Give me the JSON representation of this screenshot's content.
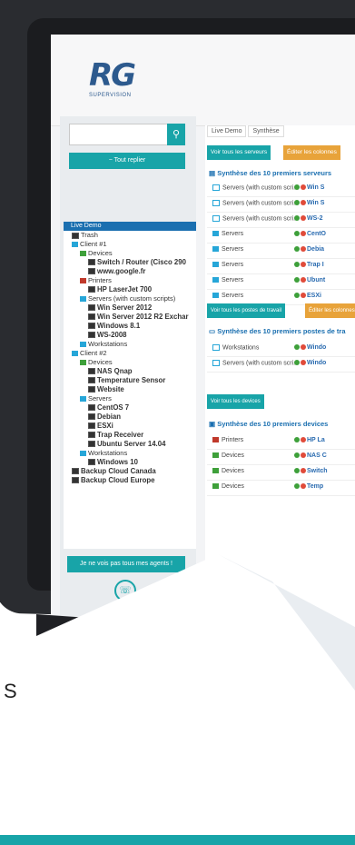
{
  "logo": {
    "mark": "RG",
    "subtitle": "SUPERVISION"
  },
  "sidebar": {
    "search_icon": "search-icon",
    "collapse_label": "− Tout replier",
    "agents_label": "Je ne vois pas tous mes agents !",
    "phone_icon": "phone-icon"
  },
  "tree": {
    "root": "Live Demo",
    "items": [
      {
        "label": "Trash",
        "level": 1,
        "bold": false,
        "icon": "trash"
      },
      {
        "label": "Client #1",
        "level": 1,
        "bold": false,
        "icon": "folder"
      },
      {
        "label": "Devices",
        "level": 2,
        "bold": false,
        "icon": "green"
      },
      {
        "label": "Switch / Router (Cisco 290",
        "level": 3,
        "bold": true,
        "icon": "dev"
      },
      {
        "label": "www.google.fr",
        "level": 3,
        "bold": true,
        "icon": "dev"
      },
      {
        "label": "Printers",
        "level": 2,
        "bold": false,
        "icon": "red"
      },
      {
        "label": "HP LaserJet 700",
        "level": 3,
        "bold": true,
        "icon": "dev"
      },
      {
        "label": "Servers (with custom scripts)",
        "level": 2,
        "bold": false,
        "icon": "folder"
      },
      {
        "label": "Win Server 2012",
        "level": 3,
        "bold": true,
        "icon": "dev"
      },
      {
        "label": "Win Server 2012 R2 Exchar",
        "level": 3,
        "bold": true,
        "icon": "dev"
      },
      {
        "label": "Windows 8.1",
        "level": 3,
        "bold": true,
        "icon": "dev"
      },
      {
        "label": "WS-2008",
        "level": 3,
        "bold": true,
        "icon": "dev"
      },
      {
        "label": "Workstations",
        "level": 2,
        "bold": false,
        "icon": "folder"
      },
      {
        "label": "Client #2",
        "level": 1,
        "bold": false,
        "icon": "folder"
      },
      {
        "label": "Devices",
        "level": 2,
        "bold": false,
        "icon": "green"
      },
      {
        "label": "NAS Qnap",
        "level": 3,
        "bold": true,
        "icon": "dev"
      },
      {
        "label": "Temperature Sensor",
        "level": 3,
        "bold": true,
        "icon": "dev"
      },
      {
        "label": "Website",
        "level": 3,
        "bold": true,
        "icon": "dev"
      },
      {
        "label": "Servers",
        "level": 2,
        "bold": false,
        "icon": "folder"
      },
      {
        "label": "CentOS 7",
        "level": 3,
        "bold": true,
        "icon": "dev"
      },
      {
        "label": "Debian",
        "level": 3,
        "bold": true,
        "icon": "dev"
      },
      {
        "label": "ESXi",
        "level": 3,
        "bold": true,
        "icon": "dev"
      },
      {
        "label": "Trap Receiver",
        "level": 3,
        "bold": true,
        "icon": "dev"
      },
      {
        "label": "Ubuntu Server 14.04",
        "level": 3,
        "bold": true,
        "icon": "dev"
      },
      {
        "label": "Workstations",
        "level": 2,
        "bold": false,
        "icon": "folder"
      },
      {
        "label": "Windows 10",
        "level": 3,
        "bold": true,
        "icon": "dev"
      },
      {
        "label": "Backup Cloud Canada",
        "level": 1,
        "bold": true,
        "icon": "dev"
      },
      {
        "label": "Backup Cloud Europe",
        "level": 1,
        "bold": true,
        "icon": "dev"
      }
    ]
  },
  "main": {
    "tabs": [
      "Live Demo",
      "Synthèse"
    ],
    "btn_all_servers": "Voir tous les serveurs",
    "btn_edit_columns": "Éditer les colonnes",
    "servers_title": "Synthèse des 10 premiers serveurs",
    "servers": [
      {
        "group": "Servers (with custom scri...",
        "name": "Win S",
        "icon": "outline"
      },
      {
        "group": "Servers (with custom scri...",
        "name": "Win S",
        "icon": "outline"
      },
      {
        "group": "Servers (with custom scri...",
        "name": "WS-2",
        "icon": "outline"
      },
      {
        "group": "Servers",
        "name": "CentO",
        "icon": "filled"
      },
      {
        "group": "Servers",
        "name": "Debia",
        "icon": "filled"
      },
      {
        "group": "Servers",
        "name": "Trap I",
        "icon": "filled"
      },
      {
        "group": "Servers",
        "name": "Ubunt",
        "icon": "filled"
      },
      {
        "group": "Servers",
        "name": "ESXi",
        "icon": "filled"
      }
    ],
    "btn_all_workstations": "Voir tous les postes de travail",
    "btn_edit_columns_2": "Éditer les colonnes",
    "workstations_title": "Synthèse des 10 premiers postes de tra",
    "workstations": [
      {
        "group": "Workstations",
        "name": "Windo",
        "icon": "outline"
      },
      {
        "group": "Servers (with custom scri...",
        "name": "Windo",
        "icon": "outline"
      }
    ],
    "btn_all_devices": "Voir tous les devices",
    "devices_title": "Synthèse des 10 premiers devices",
    "devices": [
      {
        "group": "Printers",
        "name": "HP La",
        "icon": "red"
      },
      {
        "group": "Devices",
        "name": "NAS C",
        "icon": "green"
      },
      {
        "group": "Devices",
        "name": "Switch",
        "icon": "green"
      },
      {
        "group": "Devices",
        "name": "Temp",
        "icon": "green"
      }
    ]
  },
  "page": {
    "partial_letter": "S"
  },
  "colors": {
    "accent": "#18a4a8",
    "brand": "#2d5a8e",
    "orange": "#e8a33a",
    "selected": "#1a6fb0"
  }
}
